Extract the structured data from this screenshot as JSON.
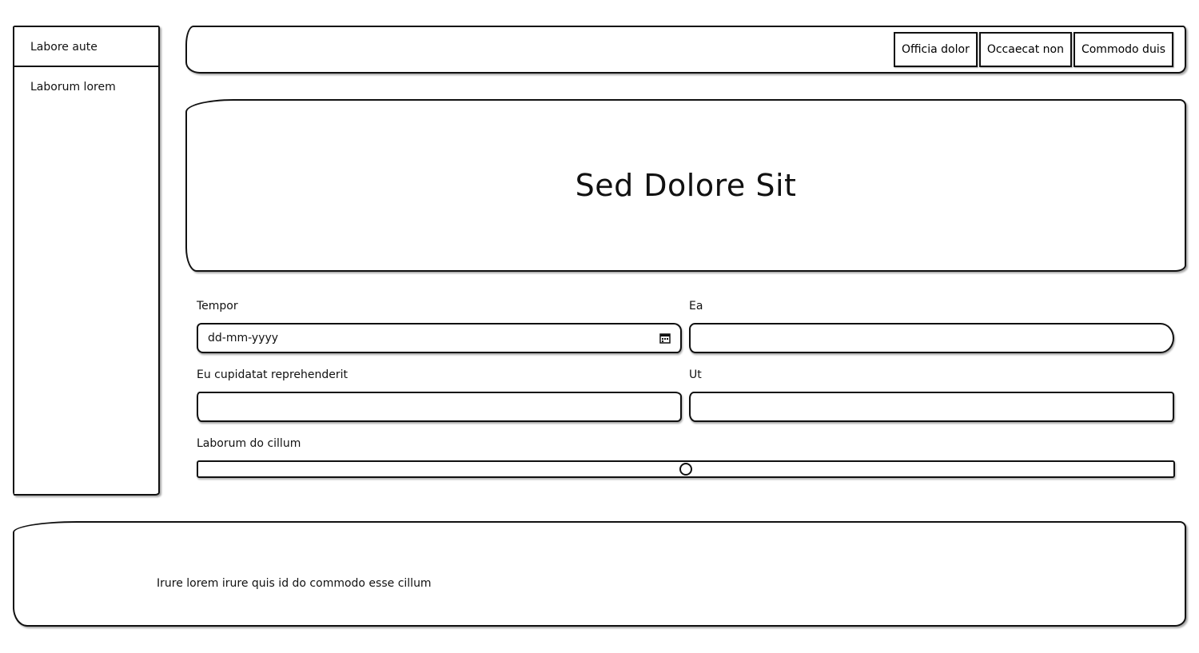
{
  "sidebar": {
    "items": [
      {
        "label": "Labore aute"
      },
      {
        "label": "Laborum lorem"
      }
    ]
  },
  "toolbar": {
    "buttons": [
      {
        "label": "Officia dolor"
      },
      {
        "label": "Occaecat non"
      },
      {
        "label": "Commodo duis"
      }
    ]
  },
  "hero": {
    "title": "Sed Dolore Sit"
  },
  "form": {
    "tempor": {
      "label": "Tempor",
      "placeholder": "dd-mm-yyyy",
      "value": ""
    },
    "ea": {
      "label": "Ea",
      "value": ""
    },
    "eu": {
      "label": "Eu cupidatat reprehenderit",
      "value": ""
    },
    "ut": {
      "label": "Ut",
      "value": ""
    },
    "slider": {
      "label": "Laborum do cillum",
      "value_fraction": 0.5
    }
  },
  "footer": {
    "text": "Irure lorem irure quis id do commodo esse cillum"
  },
  "icons": {
    "date": "calendar-icon"
  }
}
